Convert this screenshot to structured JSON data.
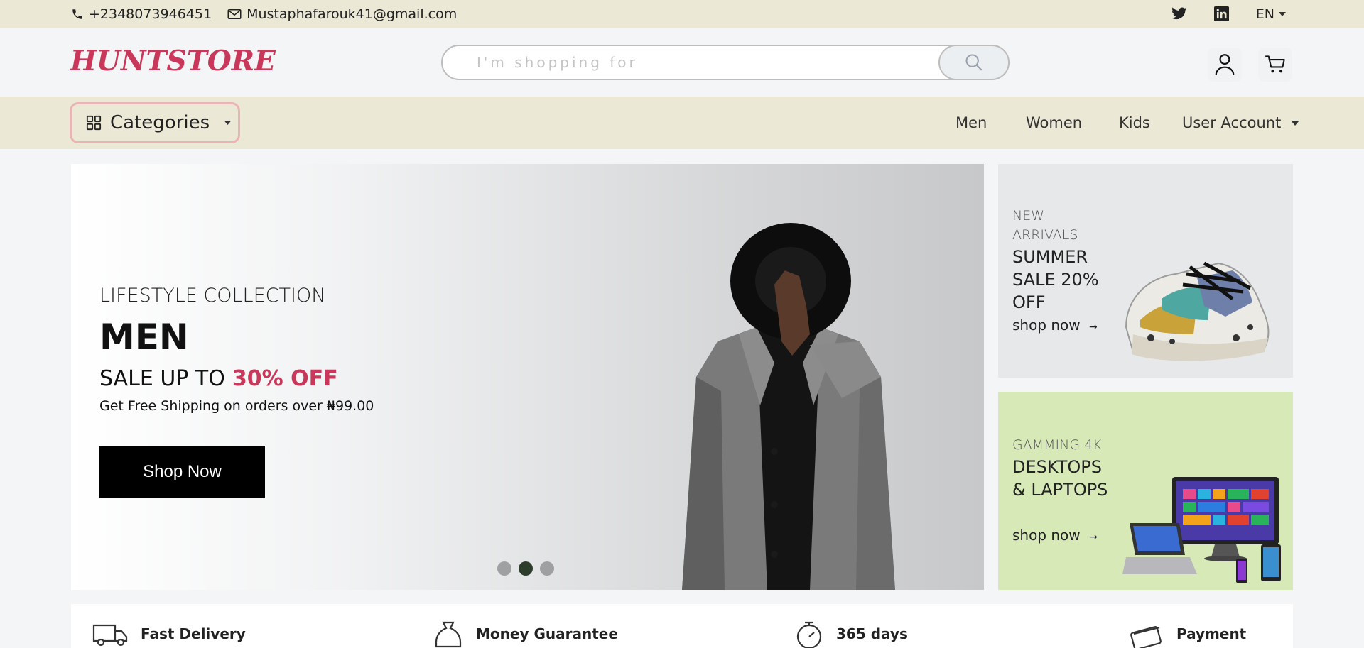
{
  "topbar": {
    "phone": "+2348073946451",
    "email": "Mustaphafarouk41@gmail.com",
    "lang": "EN"
  },
  "header": {
    "logo": "HUNTSTORE",
    "search_placeholder": "I'm shopping for"
  },
  "nav": {
    "categories_label": "Categories",
    "links": [
      "Men",
      "Women",
      "Kids",
      "User Account"
    ]
  },
  "hero": {
    "subtitle": "LIFESTYLE COLLECTION",
    "title": "MEN",
    "sale_prefix": "SALE UP TO",
    "sale_pct": "30% OFF",
    "shipping": "Get Free Shipping on orders over ₦99.00",
    "button": "Shop Now",
    "slides": 3,
    "active_slide": 2
  },
  "promos": [
    {
      "kicker": "NEW ARRIVALS",
      "title": "SUMMER SALE 20% OFF",
      "link": "shop now",
      "image": "sneaker"
    },
    {
      "kicker": "GAMMING 4K",
      "title": "DESKTOPS & LAPTOPS",
      "link": "shop now",
      "image": "devices"
    }
  ],
  "features": [
    {
      "title": "Fast Delivery",
      "icon": "truck-icon"
    },
    {
      "title": "Money Guarantee",
      "icon": "money-bag-icon"
    },
    {
      "title": "365 days",
      "icon": "stopwatch-icon"
    },
    {
      "title": "Payment",
      "icon": "credit-card-icon"
    }
  ],
  "colors": {
    "accent": "#c9385a",
    "topbar_bg": "#ebe8d6",
    "promo_green": "#d6e9b7"
  }
}
